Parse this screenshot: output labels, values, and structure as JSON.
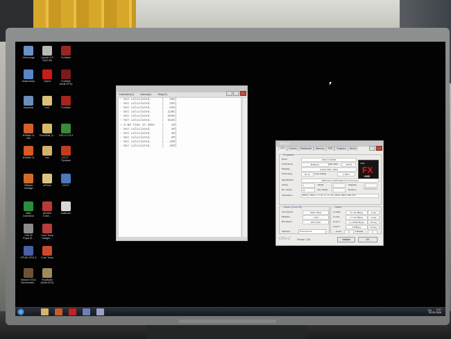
{
  "desktop_icons": [
    {
      "label": "VirtuLenga",
      "color": "#6a91c9"
    },
    {
      "label": "Launch X-F\nZ3(2) Bo",
      "color": "#b8b8b8"
    },
    {
      "label": "FurMark",
      "color": "#9a2620"
    },
    {
      "label": "Компьютер",
      "color": "#5986c6"
    },
    {
      "label": "Opera",
      "color": "#c91b1b"
    },
    {
      "label": "FurMark\n(Multi-GPU)",
      "color": "#7a1a1a"
    },
    {
      "label": "Корзина",
      "color": "#6a8fbc"
    },
    {
      "label": "LinX",
      "color": "#d9c17a"
    },
    {
      "label": "FurMark",
      "color": "#a3251d"
    },
    {
      "label": "3DMark 11\nx64",
      "color": "#d2602b"
    },
    {
      "label": "TouchBak_5...",
      "color": "#d6b96b"
    },
    {
      "label": "GPU-Z 0.5.3",
      "color": "#3a8a3a"
    },
    {
      "label": "3DMark 11",
      "color": "#d55a26"
    },
    {
      "label": "Vsc",
      "color": "#d3b26a"
    },
    {
      "label": "OCCT -\nПрофил",
      "color": "#c43b1c"
    },
    {
      "label": "3DMark\nVantage",
      "color": "#d26a28"
    },
    {
      "label": "wPrime",
      "color": "#d9c481"
    },
    {
      "label": "OCCT",
      "color": "#4a7ab9"
    },
    {
      "label": "AMD\nOverDrive",
      "color": "#2c8d3c"
    },
    {
      "label": "AIDA64\nExtre...",
      "color": "#b83939"
    },
    {
      "label": "buildozer",
      "color": "#d8d8d8"
    },
    {
      "label": "Call Of\nPrype.B...",
      "color": "#8b8b8b"
    },
    {
      "label": "Core Temp\nGadget ...",
      "color": "#b83c3c"
    },
    {
      "label": "CPUID CPU-Z",
      "color": "#4a5fa5"
    },
    {
      "label": "Core Temp",
      "color": "#c84b2f"
    },
    {
      "label": "Heaven DX11\nBenchmark...",
      "color": "#6e5236"
    },
    {
      "label": "FluidMark\n(Multi-GPU)",
      "color": "#9e8b5a"
    }
  ],
  "text_window": {
    "menu": [
      "Calculate(C)",
      "About(A)",
      "Help(H)"
    ],
    "lines": [
      "- Not calculated.      [   16K]",
      "- Not calculated.      [   32K]",
      "- Not calculated.      [   64K]",
      "- Not calculated.      [  128K]",
      "- Not calculated.      [  256K]",
      "- Not calculated.      [  512K]",
      "+ 0:00 Time 47.399s    [    1M]",
      "- Not calculated.      [    2M]",
      "- Not calculated.      [    4M]",
      "- Not calculated.      [    8M]",
      "- Not calculated.      [   16M]",
      "- Not calculated.      [   32M]"
    ]
  },
  "cpuz": {
    "title": "CPU-Z",
    "tabs": [
      "CPU",
      "Caches",
      "Mainboard",
      "Memory",
      "SPD",
      "Graphics",
      "About"
    ],
    "active_tab": "CPU",
    "processor_label": "Processor",
    "name_label": "Name",
    "name_value": "AMD FX-8150P",
    "codename_label": "Code Name",
    "codename_value": "Bulldozer",
    "maxtdp_label": "Max TDP",
    "maxtdp_value": "125 W",
    "package_label": "Package",
    "package_value": "Socket AM3+ (942)",
    "technology_label": "Technology",
    "technology_value": "32 nm",
    "corevoltage_label": "Core Voltage",
    "corevoltage_value": "1.128 V",
    "spec_label": "Specification",
    "spec_value": "AMD FX(tm)-8150 Eight-Core Processor",
    "family_label": "Family",
    "family_value": "F",
    "model_label": "Model",
    "model_value": "1",
    "stepping_label": "Stepping",
    "stepping_value": "2",
    "extfamily_label": "Ext. Family",
    "extfamily_value": "15",
    "extmodel_label": "Ext. Model",
    "extmodel_value": "1",
    "revision_label": "Revision",
    "revision_value": "",
    "instr_label": "Instructions",
    "instr_value": "MMX(+), SSE (1, 2, 3, 3S, 4.1, 4.2, 4A), x86-64, AMD-V, AES, AVX",
    "clocks_label": "Clocks (Core #0)",
    "cache_label": "Cache",
    "corespeed_label": "Core Speed",
    "corespeed_value": "4000.1 MHz",
    "multiplier_label": "Multiplier",
    "multiplier_value": "x 19.0",
    "busspeed_label": "Bus Speed",
    "busspeed_value": "200.0 MHz",
    "l1d_label": "L1 Data",
    "l1d_value": "8 x 16 KBytes",
    "l1d_way": "4-way",
    "l1i_label": "L1 Inst.",
    "l1i_value": "4 x 64 KBytes",
    "l1i_way": "2-way",
    "l2_label": "Level 2",
    "l2_value": "4 x 2048 KBytes",
    "l2_way": "16-way",
    "l3_label": "Level 3",
    "l3_value": "8 MBytes",
    "l3_way": "64-way",
    "selection_label": "Selection",
    "selection_value": "Processor #1",
    "cores_label": "Cores",
    "cores_value": "8",
    "threads_label": "Threads",
    "threads_value": "8",
    "brand": "CPU-Z",
    "version": "Version 1.58",
    "validate_label": "Validate",
    "ok_label": "OK",
    "logo_small": "AMD",
    "logo_big": "FX",
    "logo_footer": "AMD"
  },
  "taskbar": {
    "items": [
      {
        "name": "explorer",
        "color": "#d7b36b"
      },
      {
        "name": "media-player",
        "color": "#c85a27"
      },
      {
        "name": "opera",
        "color": "#c82020"
      },
      {
        "name": "app-window-1",
        "color": "#6c7fb7"
      },
      {
        "name": "app-window-2",
        "color": "#9aa0c8"
      }
    ],
    "language": "EN",
    "time": "4:37",
    "date": "05.05.2008"
  }
}
